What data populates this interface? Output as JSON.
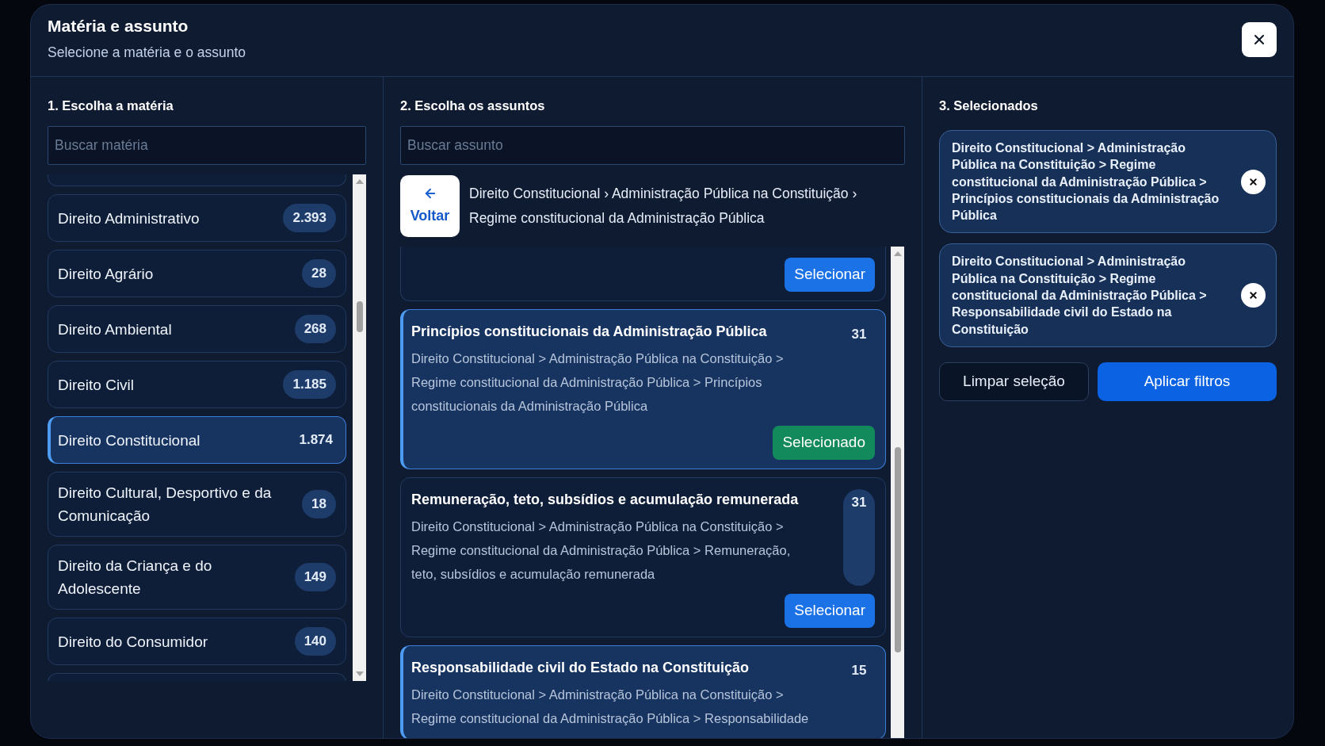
{
  "dialog": {
    "title": "Matéria e assunto",
    "subtitle": "Selecione a matéria e o assunto"
  },
  "subject_panel": {
    "heading": "1. Escolha a matéria",
    "search": {
      "placeholder": "Buscar matéria"
    },
    "more_above": true,
    "more_below": true,
    "subjects": [
      {
        "label": "Direito Administrativo",
        "count": "2.393",
        "selected": false
      },
      {
        "label": "Direito Agrário",
        "count": "28",
        "selected": false
      },
      {
        "label": "Direito Ambiental",
        "count": "268",
        "selected": false
      },
      {
        "label": "Direito Civil",
        "count": "1.185",
        "selected": false
      },
      {
        "label": "Direito Constitucional",
        "count": "1.874",
        "selected": true
      },
      {
        "label": "Direito Cultural, Desportivo e da Comunicação",
        "count": "18",
        "selected": false
      },
      {
        "label": "Direito da Criança e do Adolescente",
        "count": "149",
        "selected": false
      },
      {
        "label": "Direito do Consumidor",
        "count": "140",
        "selected": false
      }
    ]
  },
  "topic_panel": {
    "heading": "2. Escolha os assuntos",
    "search": {
      "placeholder": "Buscar assunto"
    },
    "back_button": "Voltar",
    "breadcrumb": "Direito Constitucional › Administração Pública na Constituição › Regime constitucional da Administração Pública",
    "topics": [
      {
        "button": "Selecionar",
        "selected": false
      },
      {
        "title": "Princípios constitucionais da Administração Pública",
        "count": "31",
        "path": "Direito Constitucional > Administração Pública na Constituição > Regime constitucional da Administração Pública > Princípios constitucionais da Administração Pública",
        "button": "Selecionado",
        "selected": true
      },
      {
        "title": "Remuneração, teto, subsídios e acumulação remunerada",
        "count": "31",
        "path": "Direito Constitucional > Administração Pública na Constituição > Regime constitucional da Administração Pública > Remuneração, teto, subsídios e acumulação remunerada",
        "button": "Selecionar",
        "selected": false
      },
      {
        "title": "Responsabilidade civil do Estado na Constituição",
        "count": "15",
        "path": "Direito Constitucional > Administração Pública na Constituição > Regime constitucional da Administração Pública > Responsabilidade",
        "selected": true
      }
    ]
  },
  "selected_panel": {
    "heading": "3. Selecionados",
    "chips": [
      {
        "text": "Direito Constitucional > Administração Pública na Constituição > Regime constitucional da Administração Pública > Princípios constitucionais da Administração Pública"
      },
      {
        "text": "Direito Constitucional > Administração Pública na Constituição > Regime constitucional da Administração Pública > Responsabilidade civil do Estado na Constituição"
      }
    ],
    "clear_button": "Limpar seleção",
    "apply_button": "Aplicar filtros"
  }
}
